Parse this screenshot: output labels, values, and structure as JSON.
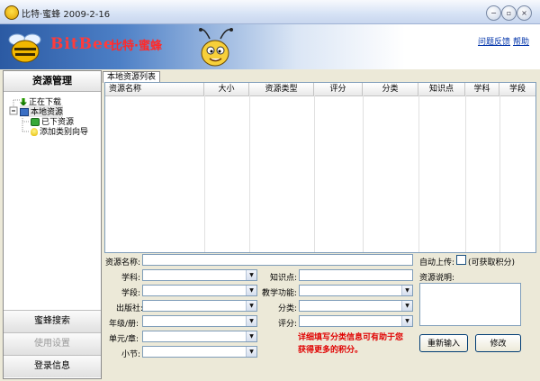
{
  "window": {
    "title": "比特·蜜蜂 2009-2-16",
    "controls": {
      "minimize": "−",
      "restore": "▫",
      "close": "×"
    }
  },
  "banner": {
    "brand_en": "BitBee",
    "brand_cn": "比特·蜜蜂",
    "links": {
      "feedback": "问题反馈",
      "help": "帮助"
    }
  },
  "left": {
    "header": "资源管理",
    "tree": [
      {
        "label": "正在下载",
        "icon": "download-arrow-icon"
      },
      {
        "label": "本地资源",
        "icon": "computer-icon"
      },
      {
        "label": "已下资源",
        "icon": "folder-icon"
      },
      {
        "label": "添加类别向导",
        "icon": "lightbulb-icon"
      }
    ],
    "nav": [
      {
        "label": "蜜蜂搜索",
        "enabled": true
      },
      {
        "label": "使用设置",
        "enabled": false
      },
      {
        "label": "登录信息",
        "enabled": true
      }
    ]
  },
  "main": {
    "tab": "本地资源列表",
    "columns": [
      "资源名称",
      "大小",
      "资源类型",
      "评分",
      "分类",
      "知识点",
      "学科",
      "学段"
    ]
  },
  "form": {
    "labels": {
      "name": "资源名称:",
      "subject": "学科:",
      "stage": "学段:",
      "publisher": "出版社:",
      "grade": "年级/册:",
      "unit": "单元/章:",
      "section": "小节:",
      "knowledge": "知识点:",
      "function": "教学功能:",
      "category": "分类:",
      "rating": "评分:",
      "auto_upload": "自动上传:",
      "earn_points": "(可获取积分)",
      "description": "资源说明:"
    },
    "values": {
      "name": "",
      "subject": "",
      "stage": "",
      "publisher": "",
      "grade": "",
      "unit": "",
      "section": "",
      "knowledge": "",
      "function": "",
      "category": "",
      "rating": "",
      "description": ""
    },
    "auto_upload_checked": false,
    "hint": "详细填写分类信息可有助于您获得更多的积分。",
    "buttons": {
      "reset": "重新输入",
      "modify": "修改"
    }
  }
}
